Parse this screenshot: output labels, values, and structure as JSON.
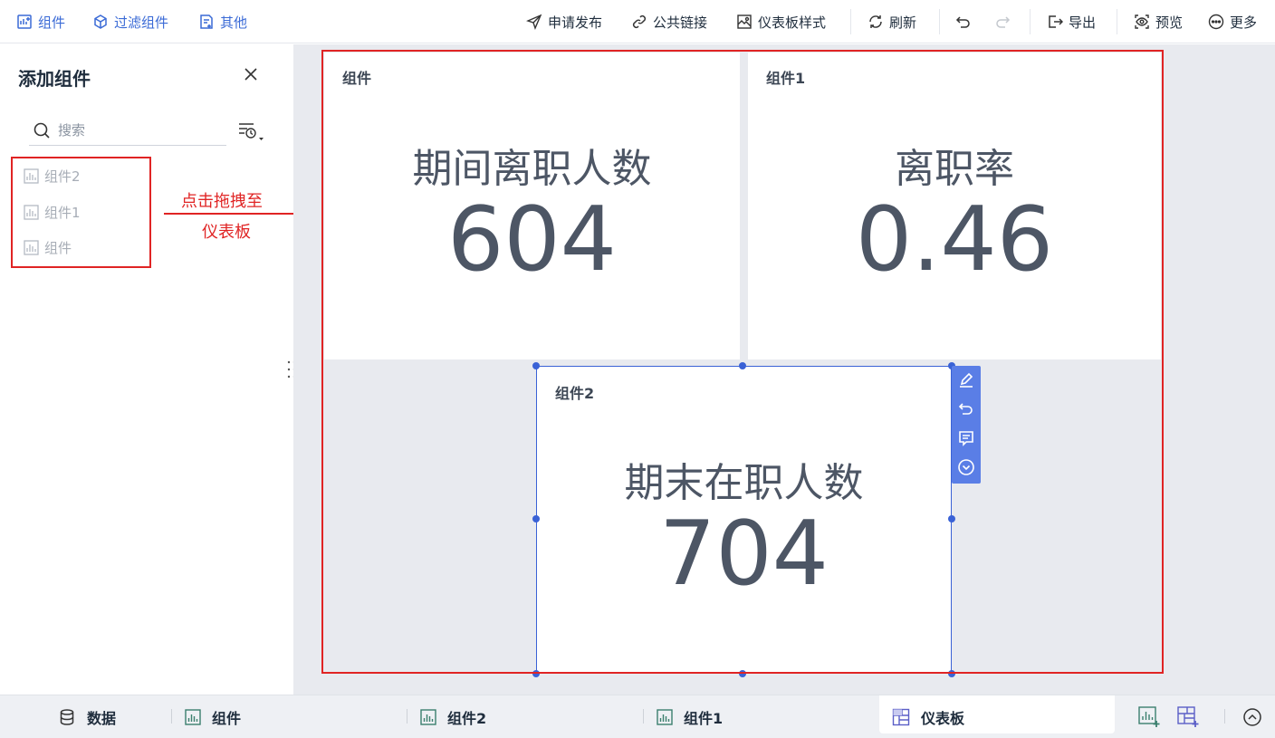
{
  "toolbar": {
    "left": [
      {
        "label": "组件",
        "icon": "add-widget-icon"
      },
      {
        "label": "过滤组件",
        "icon": "filter-widget-icon"
      },
      {
        "label": "其他",
        "icon": "other-icon"
      }
    ],
    "apply_publish": "申请发布",
    "public_link": "公共链接",
    "dashboard_style": "仪表板样式",
    "refresh": "刷新",
    "export": "导出",
    "preview": "预览",
    "more": "更多",
    "accent_color": "#3a6ad6"
  },
  "left_panel": {
    "title": "添加组件",
    "search_placeholder": "搜索",
    "items": [
      "组件2",
      "组件1",
      "组件"
    ],
    "hint_line1": "点击拖拽至",
    "hint_line2": "仪表板",
    "hint_color": "#e02424"
  },
  "widgets": [
    {
      "title": "组件",
      "label": "期间离职人数",
      "value": "604"
    },
    {
      "title": "组件1",
      "label": "离职率",
      "value": "0.46"
    },
    {
      "title": "组件2",
      "label": "期末在职人数",
      "value": "704"
    }
  ],
  "bottom_tabs": {
    "data": "数据",
    "widget": "组件",
    "widget2": "组件2",
    "widget1": "组件1",
    "dashboard": "仪表板"
  }
}
